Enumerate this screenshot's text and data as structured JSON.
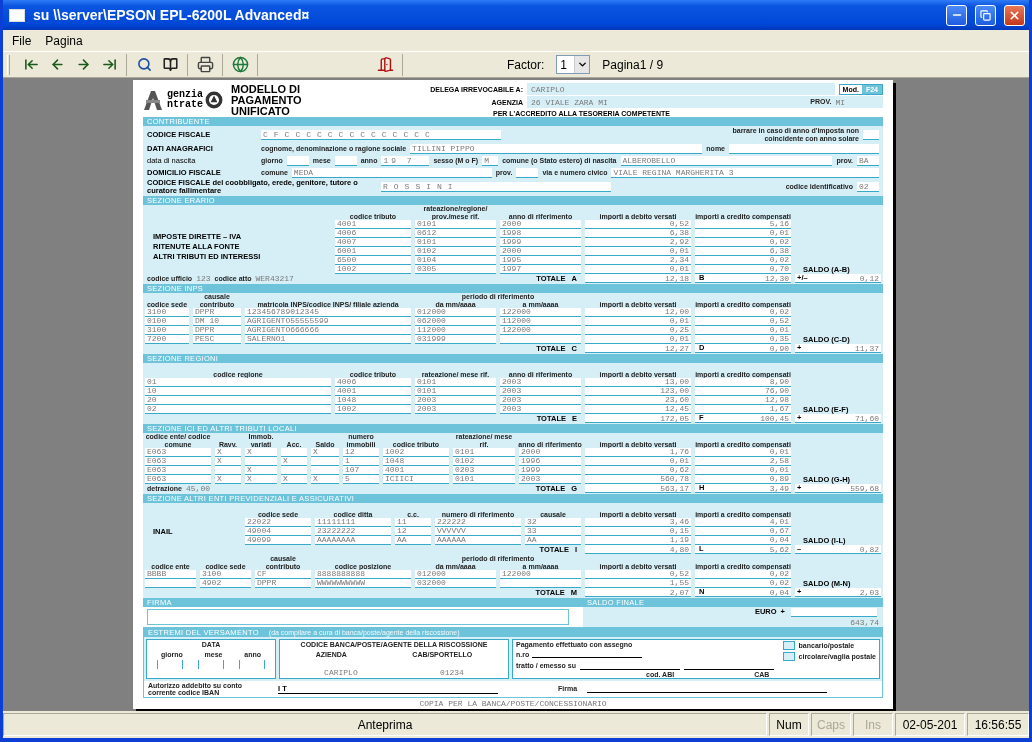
{
  "window": {
    "title": "su \\\\server\\EPSON EPL-6200L Advanced¤",
    "controls": [
      {
        "kind": "minimize"
      },
      {
        "kind": "maximize"
      },
      {
        "kind": "close"
      }
    ]
  },
  "menu": [
    "File",
    "Pagina"
  ],
  "toolbar": {
    "groups": [
      [
        {
          "kind": "first"
        },
        {
          "kind": "previous"
        },
        {
          "kind": "next"
        },
        {
          "kind": "last"
        }
      ],
      [
        {
          "kind": "zoom"
        },
        {
          "kind": "pages"
        }
      ],
      [
        {
          "kind": "print"
        }
      ],
      [
        {
          "kind": "export"
        }
      ],
      [
        {
          "kind": "exit"
        }
      ]
    ],
    "factor_label": "Factor:",
    "factor": "1",
    "page": "Pagina1 / 9"
  },
  "form": {
    "logo": [
      "genzia",
      "ntrate"
    ],
    "badge": {
      "prefix": "Mod.",
      "code": "F24"
    },
    "title": "MODELLO DI PAGAMENTO UNIFICATO",
    "delega": {
      "label": "DELEGA IRREVOCABILE A:",
      "value": "CARIPLO"
    },
    "agenzia": {
      "label": "AGENZIA",
      "value": "26 VIALE ZARA MI",
      "prov_label": "PROV.",
      "prov": "MI"
    },
    "accredito": "PER L'ACCREDITO ALLA TESORERIA COMPETENTE",
    "contribuente": {
      "title": "CONTRIBUENTE",
      "codice_fiscale": {
        "label": "CODICE FISCALE",
        "value": "CFCCCCCCCCCCCCCC"
      },
      "anno_note": "barrare in caso di anno d'imposta non coincidente con anno solare",
      "anagrafici": {
        "label": "DATI ANAGRAFICI",
        "cognome_label": "cognome, denominazione o ragione sociale",
        "cognome": "TILLINI PIPPO",
        "nome_label": "nome"
      },
      "nascita": {
        "label": "data di nascita",
        "giorno_label": "giorno",
        "mese_label": "mese",
        "anno_label": "anno",
        "anno": "19 7",
        "sesso_label": "sesso (M o F)",
        "sesso": "M",
        "comune_label": "comune (o Stato estero) di nascita",
        "comune": "ALBEROBELLO",
        "prov_label": "prov.",
        "prov": "BA"
      },
      "domicilio": {
        "label": "DOMICILIO FISCALE",
        "comune_label": "comune",
        "comune": "MEDA",
        "prov_label": "prov.",
        "via_label": "via e numero civico",
        "via": "VIALE REGINA MARGHERITA 3"
      },
      "coobbligato": {
        "label": "CODICE FISCALE del coobbligato, erede, genitore, tutore o curatore fallimentare",
        "value": "ROSSINI",
        "id_label": "codice identificativo",
        "id": "02"
      }
    },
    "sections": [
      {
        "title": "SEZIONE ERARIO",
        "blocks": [
          {
            "kind": "erario",
            "side": [
              "IMPOSTE DIRETTE – IVA",
              "RITENUTE ALLA FONTE",
              "ALTRI TRIBUTI ED INTERESSI"
            ],
            "columns": [
              {
                "label": "codice tributo"
              },
              {
                "label": "rateazione/regione/ prov./mese rif."
              },
              {
                "label": "anno di riferimento"
              },
              {
                "label": "importi a debito versati"
              },
              {
                "label": "importi a credito compensati"
              }
            ],
            "rows": [
              [
                "4001",
                "0101",
                "2000",
                "0,52",
                "5,16"
              ],
              [
                "4006",
                "0612",
                "1998",
                "6,38",
                "0,01"
              ],
              [
                "4007",
                "0101",
                "1999",
                "2,92",
                "0,02"
              ],
              [
                "6001",
                "0102",
                "2000",
                "0,01",
                "6,38"
              ],
              [
                "6500",
                "0104",
                "1995",
                "2,34",
                "0,02"
              ],
              [
                "1002",
                "0305",
                "1997",
                "0,01",
                "0,70"
              ]
            ],
            "extras": [
              {
                "label": "codice ufficio",
                "value": "123"
              },
              {
                "label": "codice atto",
                "value": "WER43217"
              }
            ],
            "totals": {
              "label": "TOTALE",
              "debit_letter": "A",
              "debit": "12,18",
              "credit_letter": "B",
              "credit": "12,30",
              "sign": "+/–",
              "saldo_label": "SALDO (A-B)",
              "saldo": "0,12"
            }
          }
        ]
      },
      {
        "title": "SEZIONE INPS",
        "blocks": [
          {
            "kind": "inps",
            "columns": [
              {
                "label": "codice sede"
              },
              {
                "label": "causale contributo"
              },
              {
                "label": "matricola INPS/codice INPS/ filiale azienda"
              },
              {
                "label": "da mm/aaaa",
                "group": "periodo di riferimento"
              },
              {
                "label": "a mm/aaaa"
              },
              {
                "label": "importi a debito versati"
              },
              {
                "label": "importi a credito compensati"
              }
            ],
            "rows": [
              [
                "3100",
                "DPPR",
                "123456789012345",
                "012000",
                "122000",
                "12,00",
                "0,02"
              ],
              [
                "0100",
                "DM 10",
                "AGRIGENTO55555599",
                "062000",
                "112000",
                "0,01",
                "0,52"
              ],
              [
                "3100",
                "DPPR",
                "AGRIGENTO666666",
                "112000",
                "122000",
                "0,25",
                "0,01"
              ],
              [
                "7200",
                "PESC",
                "SALERNO1",
                "031999",
                null,
                "0,01",
                "0,35"
              ]
            ],
            "totals": {
              "label": "TOTALE",
              "debit_letter": "C",
              "debit": "12,27",
              "credit_letter": "D",
              "credit": "0,90",
              "sign": "+",
              "saldo_label": "SALDO (C-D)",
              "saldo": "11,37"
            }
          }
        ]
      },
      {
        "title": "SEZIONE REGIONI",
        "blocks": [
          {
            "kind": "regioni",
            "columns": [
              {
                "label": "codice regione"
              },
              {
                "label": "codice tributo"
              },
              {
                "label": "rateazione/ mese rif."
              },
              {
                "label": "anno di riferimento"
              },
              {
                "label": "importi a debito versati"
              },
              {
                "label": "importi a credito compensati"
              }
            ],
            "rows": [
              [
                "01",
                "4006",
                "0101",
                "2003",
                "13,00",
                "8,90"
              ],
              [
                "10",
                "4001",
                "0101",
                "2003",
                "123,00",
                "76,90"
              ],
              [
                "20",
                "1048",
                "2003",
                "2003",
                "23,60",
                "12,98"
              ],
              [
                "02",
                "1002",
                "2003",
                "2003",
                "12,45",
                "1,67"
              ]
            ],
            "totals": {
              "label": "TOTALE",
              "debit_letter": "E",
              "debit": "172,05",
              "credit_letter": "F",
              "credit": "100,45",
              "sign": "+",
              "saldo_label": "SALDO (E-F)",
              "saldo": "71,60"
            }
          }
        ]
      },
      {
        "title": "SEZIONE ICI ED ALTRI TRIBUTI LOCALI",
        "blocks": [
          {
            "kind": "ici",
            "columns": [
              {
                "label": "codice ente/ codice comune"
              },
              {
                "label": "Ravv."
              },
              {
                "label": "Immob. variati"
              },
              {
                "label": "Acc."
              },
              {
                "label": "Saldo"
              },
              {
                "label": "numero immobili"
              },
              {
                "label": "codice tributo"
              },
              {
                "label": "rateazione/ mese rif."
              },
              {
                "label": "anno di riferimento"
              },
              {
                "label": "importi a debito versati"
              },
              {
                "label": "importi a credito compensati"
              }
            ],
            "rows": [
              [
                "E063",
                "X",
                "X",
                null,
                "X",
                "12",
                "1002",
                "0101",
                "2000",
                "1,76",
                "0,01"
              ],
              [
                "E063",
                "X",
                null,
                "X",
                null,
                "1",
                "1048",
                "0102",
                "1996",
                "0,01",
                "2,58"
              ],
              [
                "E063",
                null,
                "X",
                null,
                null,
                "107",
                "4001",
                "0203",
                "1999",
                "0,62",
                "0,01"
              ],
              [
                "E063",
                "X",
                "X",
                "X",
                "X",
                "5",
                "ICIICI",
                "0101",
                "2003",
                "560,78",
                "0,89"
              ]
            ],
            "extras": [
              {
                "label": "detrazione",
                "value": "45,00"
              }
            ],
            "totals": {
              "label": "TOTALE",
              "debit_letter": "G",
              "debit": "563,17",
              "credit_letter": "H",
              "credit": "3,49",
              "sign": "+",
              "saldo_label": "SALDO (G-H)",
              "saldo": "559,68"
            }
          }
        ]
      },
      {
        "title": "SEZIONE ALTRI ENTI PREVIDENZIALI E ASSICURATIVI",
        "blocks": [
          {
            "kind": "inail",
            "side": [
              "INAIL"
            ],
            "columns": [
              {
                "label": "codice sede"
              },
              {
                "label": "codice ditta"
              },
              {
                "label": "c.c."
              },
              {
                "label": "numero di riferimento"
              },
              {
                "label": "causale"
              },
              {
                "label": "importi a debito versati"
              },
              {
                "label": "importi a credito compensati"
              }
            ],
            "rows": [
              [
                "22022",
                "11111111",
                "11",
                "222222",
                "32",
                "3,46",
                "4,01"
              ],
              [
                "49004",
                "23222222",
                "12",
                "VVVVVV",
                "33",
                "0,15",
                "0,67"
              ],
              [
                "49099",
                "AAAAAAAA",
                "AA",
                "AAAAAA",
                "AA",
                "1,19",
                "0,04"
              ]
            ],
            "totals": {
              "label": "TOTALE",
              "debit_letter": "I",
              "debit": "4,80",
              "credit_letter": "L",
              "credit": "5,62",
              "sign": "–",
              "saldo_label": "SALDO (I-L)",
              "saldo": "0,82"
            }
          },
          {
            "kind": "enti",
            "columns": [
              {
                "label": "codice ente"
              },
              {
                "label": "codice sede"
              },
              {
                "label": "causale contributo"
              },
              {
                "label": "codice posizione"
              },
              {
                "label": "da mm/aaaa",
                "group": "periodo di riferimento"
              },
              {
                "label": "a mm/aaaa"
              },
              {
                "label": "importi a debito versati"
              },
              {
                "label": "importi a credito compensati"
              }
            ],
            "rows": [
              [
                "BBBB",
                "3100",
                "CF",
                "8888888888",
                "012000",
                "122000",
                "0,52",
                "0,02"
              ],
              [
                null,
                "4902",
                "DPPR",
                "WWWWWWWWWW",
                "032000",
                null,
                "1,55",
                "0,02"
              ]
            ],
            "totals": {
              "label": "TOTALE",
              "debit_letter": "M",
              "debit": "2,07",
              "credit_letter": "N",
              "credit": "0,04",
              "sign": "+",
              "saldo_label": "SALDO (M-N)",
              "saldo": "2,03"
            }
          }
        ]
      }
    ],
    "firma": {
      "label": "FIRMA",
      "saldo_label": "SALDO FINALE",
      "euro_label": "EURO",
      "sign": "+",
      "value": "643,74"
    },
    "estremi": {
      "title": "ESTREMI DEL VERSAMENTO",
      "note": "(da compilare a cura di banca/poste/agente della riscossione)",
      "data_label": "DATA",
      "giorno": "giorno",
      "mese": "mese",
      "anno": "anno",
      "banca_label": "CODICE BANCA/POSTE/AGENTE DELLA RISCOSSIONE",
      "azienda_label": "AZIENDA",
      "azienda": "CARIPLO",
      "cab_label": "CAB/SPORTELLO",
      "cab": "01234",
      "assegno": "Pagamento effettuato con assegno",
      "nro": "n.ro",
      "tratto": "tratto / emesso su",
      "abi": "cod. ABI",
      "cab2": "CAB",
      "checks": [
        {
          "label": "bancario/postale",
          "checked": false
        },
        {
          "label": "circolare/vaglia postale",
          "checked": false
        }
      ],
      "iban_label": "Autorizzo addebito su conto corrente codice IBAN",
      "iban": "I T",
      "firma": "Firma"
    },
    "footer": "COPIA PER LA BANCA/POSTE/CONCESSIONARIO"
  },
  "status": {
    "text": "Anteprima",
    "indicators": [
      {
        "label": "Num",
        "on": true
      },
      {
        "label": "Caps",
        "on": false
      },
      {
        "label": "Ins",
        "on": false
      }
    ],
    "date": "02-05-201",
    "time": "16:56:55"
  }
}
